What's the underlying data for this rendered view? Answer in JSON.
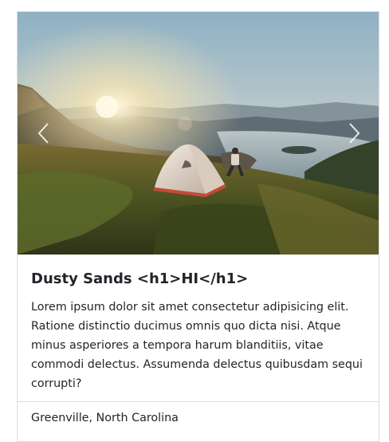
{
  "card": {
    "image_alt": "Tent on a mountain meadow at sunrise overlooking a lake",
    "carousel": {
      "prev_icon": "chevron-left-icon",
      "next_icon": "chevron-right-icon"
    },
    "title": "Dusty Sands <h1>HI</h1>",
    "description": "Lorem ipsum dolor sit amet consectetur adipisicing elit. Ratione distinctio ducimus omnis quo dicta nisi. Atque minus asperiores a tempora harum blanditiis, vitae commodi delectus. Assumenda delectus quibusdam sequi corrupti?",
    "location": "Greenville, North Carolina"
  }
}
